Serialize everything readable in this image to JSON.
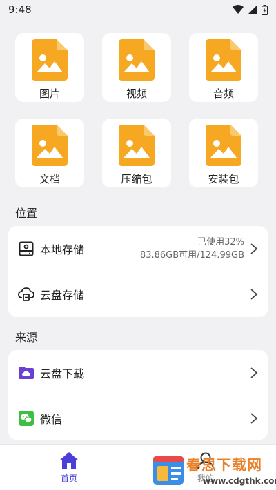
{
  "status_bar": {
    "time": "9:48"
  },
  "categories": [
    {
      "label": "图片",
      "icon": "image-file-icon"
    },
    {
      "label": "视频",
      "icon": "image-file-icon"
    },
    {
      "label": "音频",
      "icon": "image-file-icon"
    },
    {
      "label": "文档",
      "icon": "image-file-icon"
    },
    {
      "label": "压缩包",
      "icon": "image-file-icon"
    },
    {
      "label": "安装包",
      "icon": "image-file-icon"
    }
  ],
  "location": {
    "title": "位置",
    "local": {
      "label": "本地存储",
      "used": "已使用32%",
      "capacity": "83.86GB可用/124.99GB"
    },
    "cloud": {
      "label": "云盘存储"
    }
  },
  "source": {
    "title": "来源",
    "cloud_download": {
      "label": "云盘下载"
    },
    "wechat": {
      "label": "微信"
    }
  },
  "nav": {
    "home": "首页",
    "mine": "我的"
  },
  "watermark": {
    "text": "春思下载网",
    "url": "www.cdgthk.com"
  },
  "colors": {
    "accent": "#4a3fd6",
    "file_icon": "#f7a823",
    "wechat": "#3dbe44",
    "purple_folder": "#6b3fd1"
  }
}
